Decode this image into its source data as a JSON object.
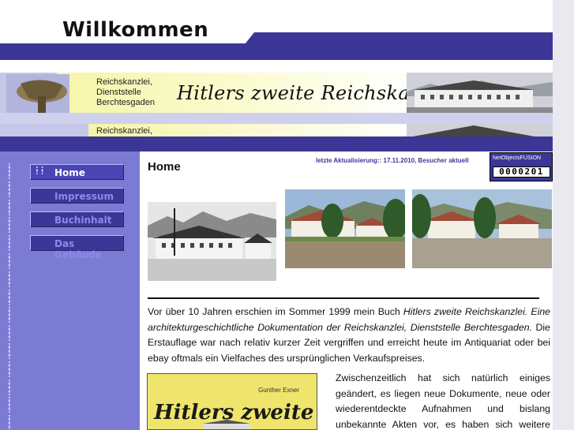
{
  "header": {
    "title": "Willkommen"
  },
  "banner": {
    "subtitle": "Reichskanzlei,\nDienststelle\nBerchtesgaden",
    "title": "Hitlers zweite Reichskanzlei",
    "sub2": "Reichskanzlei,"
  },
  "nav": {
    "items": [
      {
        "label": "Home"
      },
      {
        "label": "Impressum"
      },
      {
        "label": "Buchinhalt"
      },
      {
        "label": "Das Gebäude"
      }
    ]
  },
  "main": {
    "heading": "Home",
    "update_text": "letzte Aktualisierung:: 17.11.2010, Besucher aktuell",
    "counter": {
      "brand": "NetObjectsFUSION",
      "digits": "0000201"
    },
    "paragraph1_a": "Vor über 10 Jahren erschien im Sommer 1999 mein Buch ",
    "paragraph1_italic": "Hitlers zweite Reichskanzlei. Eine architekturgeschichtliche Dokumentation der Reichskanzlei, Dienststelle Berchtesgaden.",
    "paragraph1_b": " Die Erstauflage war nach relativ kurzer Zeit vergriffen und erreicht heute im Antiquariat oder bei ebay oftmals ein Vielfaches des ursprünglichen Verkaufspreises.",
    "book": {
      "author": "Gunther Exner",
      "title": "Hitlers zweite"
    },
    "paragraph2": "Zwischenzeitlich hat sich natürlich einiges geändert, es liegen neue Dokumente, neue oder wiederentdeckte Aufnahmen und bislang unbekannte Akten vor, es haben sich weitere Zeitzeugen gemeldet und vieles andere mehr"
  },
  "colors": {
    "navy": "#3c3796",
    "sidebar": "#7b7bd4",
    "banner_yellow": "#f5f5a8"
  }
}
